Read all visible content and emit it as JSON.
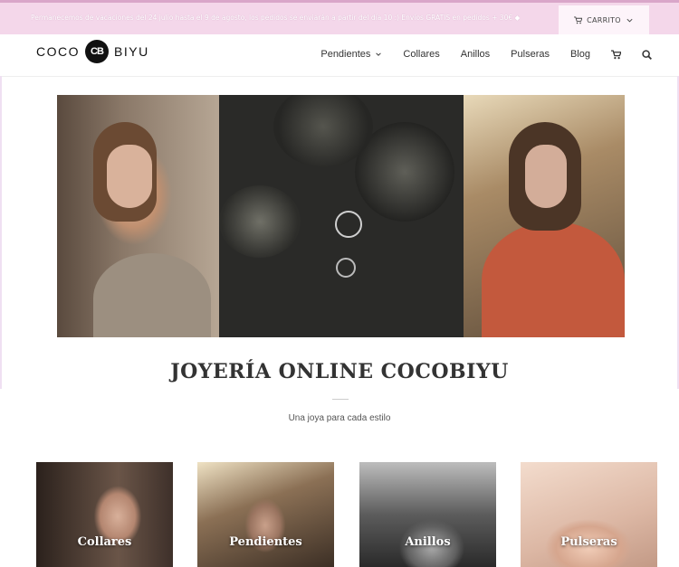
{
  "topbar": {
    "message": "Permanecemos de vacaciones del 24 julio hasta el 9 de agosto, los pedidos se enviarán a partir del día 10 :) Envíos GRATIS en pedidos + 30€ ◆",
    "cart_label": "CARRITO"
  },
  "header": {
    "logo_left": "COCO",
    "logo_mark": "CB",
    "logo_right": "BIYU",
    "nav": [
      {
        "label": "Pendientes",
        "has_dropdown": true
      },
      {
        "label": "Collares"
      },
      {
        "label": "Anillos"
      },
      {
        "label": "Pulseras"
      },
      {
        "label": "Blog"
      }
    ],
    "icons": [
      "cart-icon",
      "search-icon"
    ]
  },
  "main": {
    "title": "JOYERÍA ONLINE COCOBIYU",
    "subtitle": "Una joya para cada estilo",
    "categories": [
      {
        "label": "Collares"
      },
      {
        "label": "Pendientes"
      },
      {
        "label": "Anillos"
      },
      {
        "label": "Pulseras"
      }
    ]
  },
  "colors": {
    "topbar_bg": "#f4d7ea",
    "accent": "#d9a6c9",
    "text": "#333333"
  }
}
